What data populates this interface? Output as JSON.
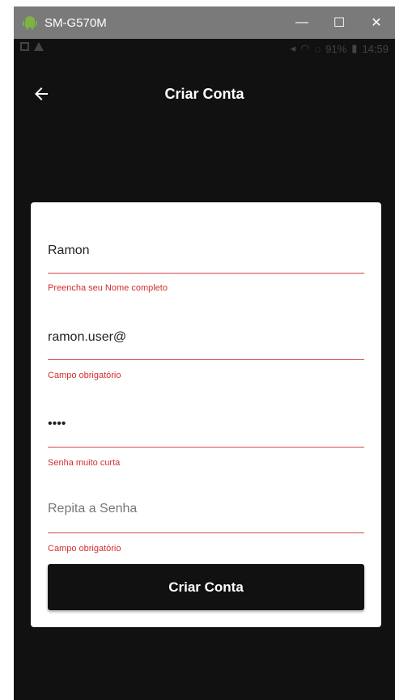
{
  "window": {
    "title": "SM-G570M",
    "minimize": "—",
    "maximize": "☐",
    "close": "✕"
  },
  "statusbar": {
    "battery": "91%",
    "time": "14:59"
  },
  "appbar": {
    "title": "Criar Conta"
  },
  "form": {
    "name": {
      "value": "Ramon",
      "error": "Preencha seu Nome completo"
    },
    "email": {
      "value": "ramon.user@",
      "error": "Campo obrigatório"
    },
    "password": {
      "value": "••••",
      "error": "Senha muito curta"
    },
    "repeat_password": {
      "placeholder": "Repita a Senha",
      "error": "Campo obrigatório"
    },
    "submit_label": "Criar Conta"
  },
  "colors": {
    "error": "#d32f2f",
    "background": "#111111",
    "card": "#ffffff"
  }
}
